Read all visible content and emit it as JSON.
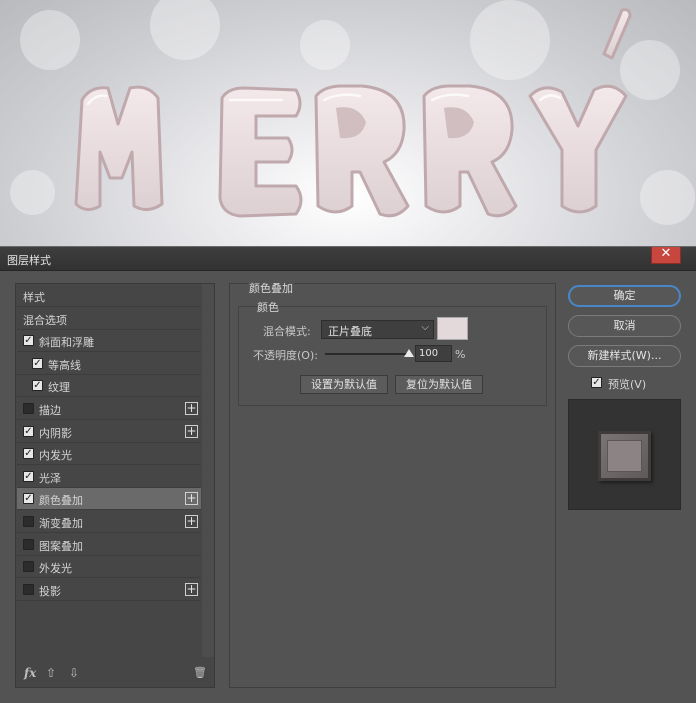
{
  "dialog": {
    "title": "图层样式",
    "close_glyph": "✕"
  },
  "style_list": {
    "items": [
      {
        "label": "样式",
        "checkbox": false,
        "checked": false,
        "plus": false,
        "indent": false
      },
      {
        "label": "混合选项",
        "checkbox": false,
        "checked": false,
        "plus": false,
        "indent": false
      },
      {
        "label": "斜面和浮雕",
        "checkbox": true,
        "checked": true,
        "plus": false,
        "indent": false
      },
      {
        "label": "等高线",
        "checkbox": true,
        "checked": true,
        "plus": false,
        "indent": true
      },
      {
        "label": "纹理",
        "checkbox": true,
        "checked": true,
        "plus": false,
        "indent": true
      },
      {
        "label": "描边",
        "checkbox": true,
        "checked": false,
        "plus": true,
        "indent": false
      },
      {
        "label": "内阴影",
        "checkbox": true,
        "checked": true,
        "plus": true,
        "indent": false
      },
      {
        "label": "内发光",
        "checkbox": true,
        "checked": true,
        "plus": false,
        "indent": false
      },
      {
        "label": "光泽",
        "checkbox": true,
        "checked": true,
        "plus": false,
        "indent": false
      },
      {
        "label": "颜色叠加",
        "checkbox": true,
        "checked": true,
        "plus": true,
        "indent": false,
        "selected": true
      },
      {
        "label": "渐变叠加",
        "checkbox": true,
        "checked": false,
        "plus": true,
        "indent": false
      },
      {
        "label": "图案叠加",
        "checkbox": true,
        "checked": false,
        "plus": false,
        "indent": false
      },
      {
        "label": "外发光",
        "checkbox": true,
        "checked": false,
        "plus": false,
        "indent": false
      },
      {
        "label": "投影",
        "checkbox": true,
        "checked": false,
        "plus": true,
        "indent": false
      }
    ],
    "footer": {
      "fx_label": "fx",
      "up_glyph": "⇧",
      "down_glyph": "⇩",
      "trash_glyph": "🗑"
    }
  },
  "color_overlay": {
    "section_title": "颜色叠加",
    "group_title": "颜色",
    "blend_label": "混合模式:",
    "blend_value": "正片叠底",
    "overlay_color": "#e3d8da",
    "opacity_label": "不透明度(O):",
    "opacity_value": "100",
    "opacity_fraction": 1.0,
    "opacity_unit": "%",
    "make_default": "设置为默认值",
    "reset_default": "复位为默认值"
  },
  "actions": {
    "ok": "确定",
    "cancel": "取消",
    "new_style": "新建样式(W)...",
    "preview_label": "预览(V)",
    "preview_checked": true
  },
  "icons": {
    "plus": "plus-icon",
    "checkmark": "checkmark-icon",
    "dropdown": "chevron-down-icon",
    "slider_thumb": "triangle-icon"
  }
}
